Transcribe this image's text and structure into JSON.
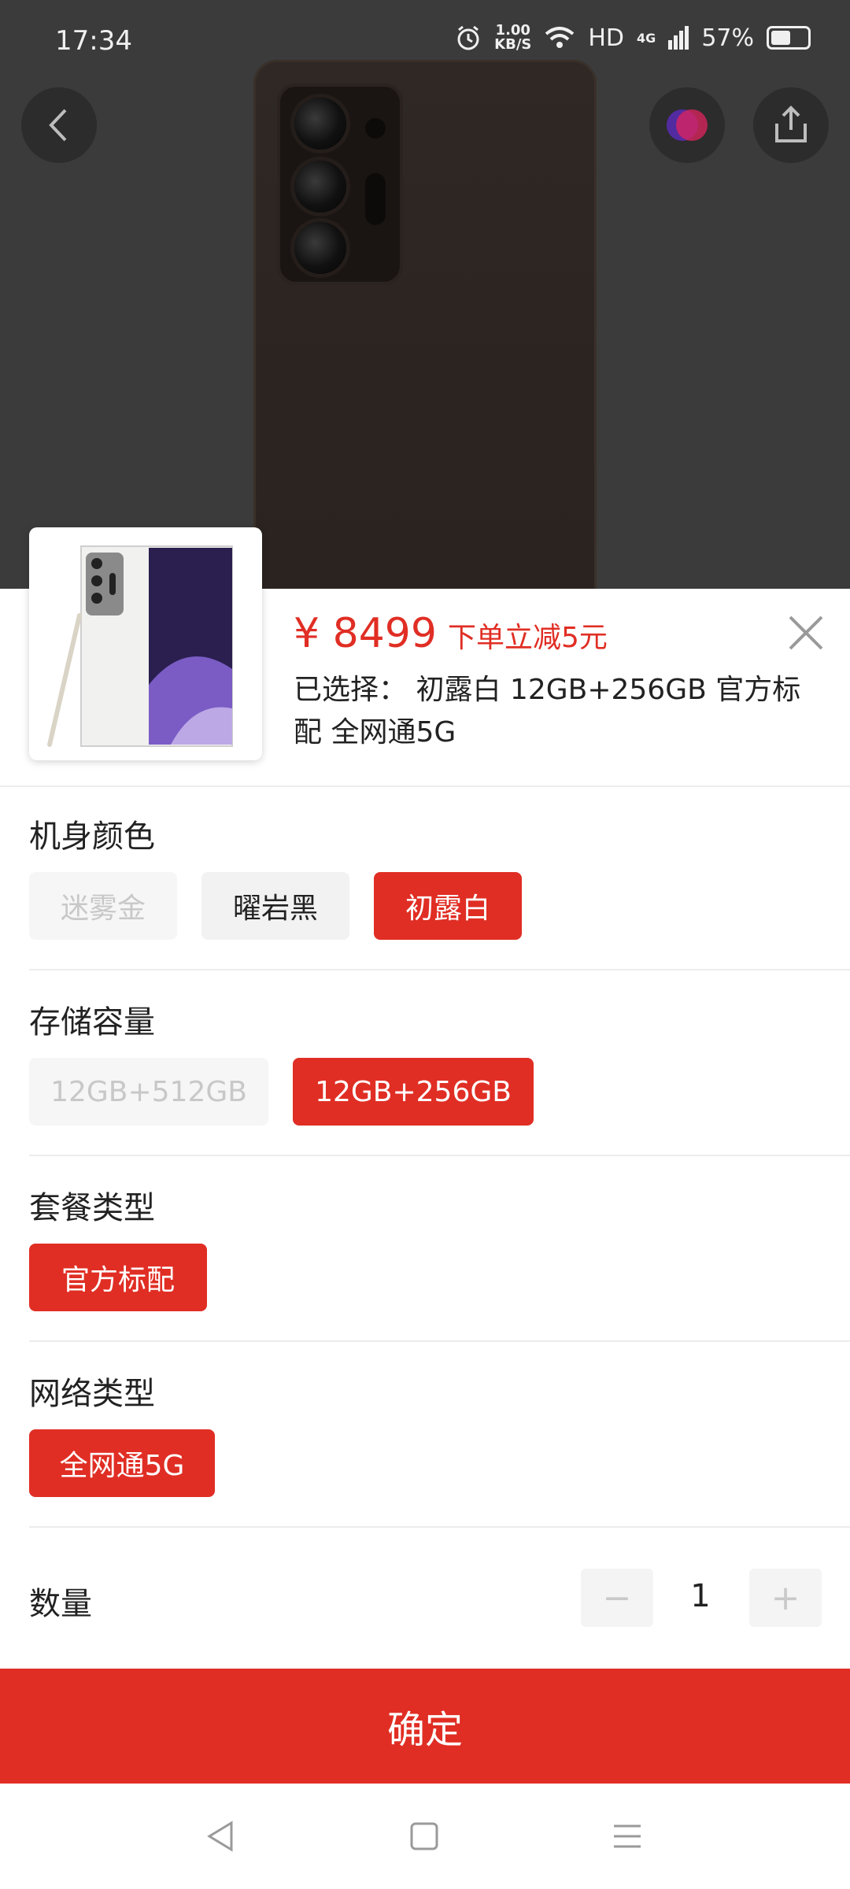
{
  "status_bar": {
    "time": "17:34",
    "net_speed_value": "1.00",
    "net_speed_unit": "KB/S",
    "hd": "HD",
    "signal": "4G",
    "battery": "57%"
  },
  "product": {
    "price": "¥ 8499",
    "promo": "下单立减5元",
    "selected_label": "已选择：",
    "selected_value": "初露白 12GB+256GB 官方标配 全网通5G"
  },
  "sections": {
    "color": {
      "title": "机身颜色",
      "options": [
        {
          "label": "迷雾金",
          "state": "disabled"
        },
        {
          "label": "曜岩黑",
          "state": "normal"
        },
        {
          "label": "初露白",
          "state": "selected"
        }
      ]
    },
    "storage": {
      "title": "存储容量",
      "options": [
        {
          "label": "12GB+512GB",
          "state": "disabled"
        },
        {
          "label": "12GB+256GB",
          "state": "selected"
        }
      ]
    },
    "package": {
      "title": "套餐类型",
      "options": [
        {
          "label": "官方标配",
          "state": "selected"
        }
      ]
    },
    "network": {
      "title": "网络类型",
      "options": [
        {
          "label": "全网通5G",
          "state": "selected"
        }
      ]
    }
  },
  "quantity": {
    "label": "数量",
    "minus": "−",
    "value": "1",
    "plus": "+"
  },
  "confirm_label": "确定",
  "colors": {
    "accent": "#e02e24",
    "chip_bg": "#f2f2f2",
    "disabled_text": "#c8c8c8"
  },
  "icons": {
    "back": "chevron-left-icon",
    "avatar": "assistant-avatar-icon",
    "share": "share-icon",
    "close": "close-icon",
    "nav_back": "triangle-back-icon",
    "nav_home": "square-home-icon",
    "nav_menu": "menu-lines-icon"
  }
}
